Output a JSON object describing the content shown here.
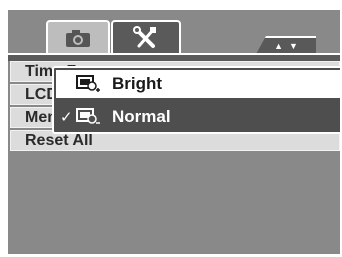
{
  "menu": {
    "rows": [
      {
        "label": "Time Zone"
      },
      {
        "label": "LCD Brightness"
      },
      {
        "label": "Memory Kit"
      },
      {
        "label": "Reset All"
      }
    ]
  },
  "tabs": [
    {
      "icon": "camera-icon",
      "selected": false
    },
    {
      "icon": "wrench-screwdriver-icon",
      "selected": true
    }
  ],
  "scroll_indicator": {
    "up": "▲",
    "down": "▼"
  },
  "popup": {
    "options": [
      {
        "label": "Bright",
        "icon": "lcd-bright-icon",
        "checked": false
      },
      {
        "label": "Normal",
        "icon": "lcd-normal-icon",
        "checked": true
      }
    ],
    "check_mark": "✓"
  },
  "colors": {
    "background": "#898989",
    "panel": "#5a5a5a",
    "row": "#dcdcdc",
    "highlight": "#ffffff"
  }
}
